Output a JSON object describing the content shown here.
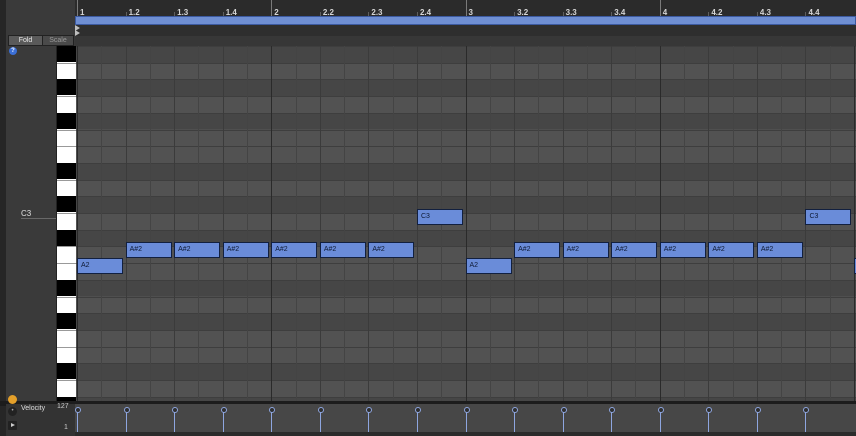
{
  "ruler": {
    "labels": [
      "1",
      "1.2",
      "1.3",
      "1.4",
      "2",
      "2.2",
      "2.3",
      "2.4",
      "3",
      "3.2",
      "3.3",
      "3.4",
      "4",
      "4.2",
      "4.3",
      "4.4"
    ]
  },
  "left_panel": {
    "fold_label": "Fold",
    "scale_label": "Scale",
    "c3_label": "C3",
    "help_icon": "?"
  },
  "notes": [
    {
      "pitch": "A2",
      "start": 1.0
    },
    {
      "pitch": "A#2",
      "start": 1.25
    },
    {
      "pitch": "A#2",
      "start": 1.5
    },
    {
      "pitch": "A#2",
      "start": 1.75
    },
    {
      "pitch": "A#2",
      "start": 2.0
    },
    {
      "pitch": "A#2",
      "start": 2.25
    },
    {
      "pitch": "A#2",
      "start": 2.5
    },
    {
      "pitch": "C3",
      "start": 2.75
    },
    {
      "pitch": "A2",
      "start": 3.0
    },
    {
      "pitch": "A#2",
      "start": 3.25
    },
    {
      "pitch": "A#2",
      "start": 3.5
    },
    {
      "pitch": "A#2",
      "start": 3.75
    },
    {
      "pitch": "A#2",
      "start": 4.0
    },
    {
      "pitch": "A#2",
      "start": 4.25
    },
    {
      "pitch": "A#2",
      "start": 4.5
    },
    {
      "pitch": "C3",
      "start": 4.75
    },
    {
      "pitch": "A",
      "start": 5.0
    }
  ],
  "velocity": {
    "label": "Velocity",
    "max_label": "127",
    "min_label": "1"
  },
  "colors": {
    "note_fill": "#6a8cd9",
    "loop_bar": "#6f8fd3",
    "accent_orange": "#e4a02a"
  }
}
